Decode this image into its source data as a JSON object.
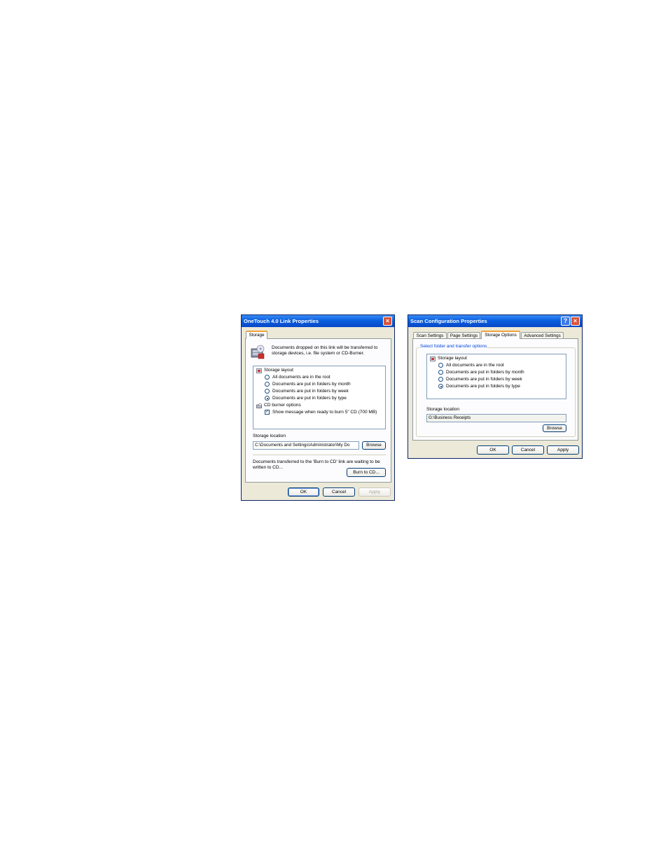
{
  "dialog1": {
    "title": "OneTouch 4.0 Link Properties",
    "close_glyph": "×",
    "tabs": [
      {
        "label": "Storage"
      }
    ],
    "description": "Documents dropped on this link will be transferred to storage devices, i.e. file system or CD-Burner.",
    "description_line1": "Documents dropped on this link will be transferred to",
    "description_line2": "storage devices, i.e. file system or CD-Burner.",
    "tree": {
      "storage_layout_label": "Storage layout",
      "options": [
        {
          "label": "All documents are in the root",
          "selected": false
        },
        {
          "label": "Documents are put in folders by month",
          "selected": false
        },
        {
          "label": "Documents are put in folders by week",
          "selected": false
        },
        {
          "label": "Documents are put in folders by type",
          "selected": true
        }
      ],
      "cd_burner_label": "CD burner options",
      "cd_checkbox_label": "Show message when ready to burn 5\" CD (700 MB)",
      "cd_checkbox_checked": true,
      "check_glyph": "✓"
    },
    "storage_location_label": "Storage location",
    "storage_location_value": "C:\\Documents and Settings\\Administrator\\My Do",
    "browse_label": "Browse",
    "burn_text_line1": "Documents transferred to the 'Burn to CD' link are waiting to be",
    "burn_text_line2": "written to CD...",
    "burn_button_label": "Burn to CD...",
    "ok_label": "OK",
    "cancel_label": "Cancel",
    "apply_label": "Apply"
  },
  "dialog2": {
    "title": "Scan Configuration Properties",
    "help_glyph": "?",
    "close_glyph": "×",
    "tabs": [
      {
        "label": "Scan Settings"
      },
      {
        "label": "Page Settings"
      },
      {
        "label": "Storage Options"
      },
      {
        "label": "Advanced Settings"
      }
    ],
    "active_tab": "Storage Options",
    "group_legend": "Select folder and transfer options",
    "tree": {
      "storage_layout_label": "Storage layout",
      "options": [
        {
          "label": "All documents are in the root",
          "selected": false
        },
        {
          "label": "Documents are put in folders by month",
          "selected": false
        },
        {
          "label": "Documents are put in folders by week",
          "selected": false
        },
        {
          "label": "Documents are put in folders by type",
          "selected": true
        }
      ]
    },
    "storage_location_label": "Storage location",
    "storage_location_value": "G:\\Business Receipts",
    "browse_label": "Browse",
    "ok_label": "OK",
    "cancel_label": "Cancel",
    "apply_label": "Apply"
  }
}
